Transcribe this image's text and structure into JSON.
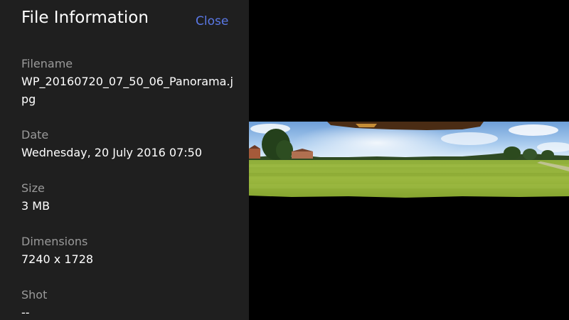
{
  "panel": {
    "title": "File Information",
    "close_label": "Close"
  },
  "fields": {
    "filename": {
      "label": "Filename",
      "value": "WP_20160720_07_50_06_Panorama.jpg"
    },
    "date": {
      "label": "Date",
      "value": "Wednesday, 20 July 2016 07:50"
    },
    "size": {
      "label": "Size",
      "value": "3 MB"
    },
    "dimensions": {
      "label": "Dimensions",
      "value": "7240 x 1728"
    },
    "shot": {
      "label": "Shot",
      "value": "--"
    }
  },
  "colors": {
    "panel_background": "#1f1f1f",
    "accent": "#5a78e6",
    "label_text": "#9a9a9a",
    "value_text": "#ffffff"
  }
}
